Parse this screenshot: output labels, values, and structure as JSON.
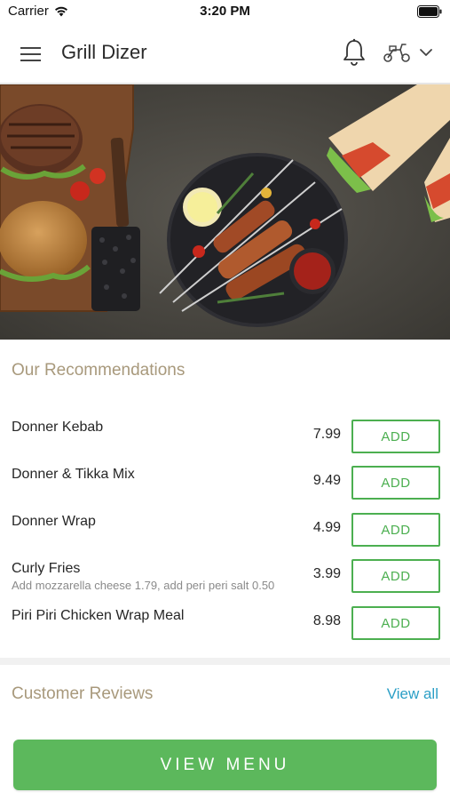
{
  "status_bar": {
    "carrier": "Carrier",
    "time": "3:20 PM"
  },
  "header": {
    "title": "Grill Dizer",
    "icons": [
      "menu-icon",
      "bell-icon",
      "scooter-icon",
      "chevron-down-icon"
    ]
  },
  "hero": {
    "image": "grill-food-banner"
  },
  "recommendations": {
    "title": "Our Recommendations",
    "add_label": "ADD",
    "items": [
      {
        "name": "Donner Kebab",
        "price": "7.99",
        "desc": ""
      },
      {
        "name": "Donner & Tikka Mix",
        "price": "9.49",
        "desc": ""
      },
      {
        "name": "Donner Wrap",
        "price": "4.99",
        "desc": ""
      },
      {
        "name": "Curly Fries",
        "price": "3.99",
        "desc": "Add mozzarella cheese 1.79, add peri peri salt 0.50"
      },
      {
        "name": "Piri Piri Chicken Wrap Meal",
        "price": "8.98",
        "desc": ""
      }
    ]
  },
  "reviews": {
    "title": "Customer Reviews",
    "view_all": "View all"
  },
  "footer": {
    "view_menu": "VIEW MENU"
  },
  "colors": {
    "accent_green": "#5cb85c",
    "add_border": "#4caf50",
    "section_title": "#a8997c",
    "link": "#2b9fc6"
  }
}
